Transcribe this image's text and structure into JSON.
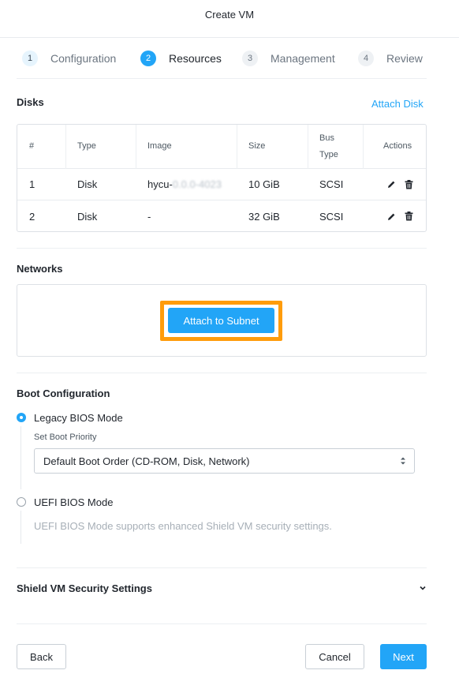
{
  "header": {
    "title": "Create VM"
  },
  "steps": [
    {
      "number": "1",
      "label": "Configuration"
    },
    {
      "number": "2",
      "label": "Resources"
    },
    {
      "number": "3",
      "label": "Management"
    },
    {
      "number": "4",
      "label": "Review"
    }
  ],
  "disks": {
    "title": "Disks",
    "attach_label": "Attach Disk",
    "columns": {
      "num": "#",
      "type": "Type",
      "image": "Image",
      "size": "Size",
      "bus_line1": "Bus",
      "bus_line2": "Type",
      "actions": "Actions"
    },
    "rows": [
      {
        "num": "1",
        "type": "Disk",
        "image": "hycu-",
        "image_redacted": "0.0.0-4023",
        "size": "10 GiB",
        "bus": "SCSI"
      },
      {
        "num": "2",
        "type": "Disk",
        "image": "-",
        "size": "32 GiB",
        "bus": "SCSI"
      }
    ],
    "action_icons": [
      "pencil-icon",
      "trash-icon"
    ]
  },
  "networks": {
    "title": "Networks",
    "attach_label": "Attach to Subnet"
  },
  "boot": {
    "title": "Boot Configuration",
    "legacy_label": "Legacy BIOS Mode",
    "priority_label": "Set Boot Priority",
    "priority_value": "Default Boot Order (CD-ROM, Disk, Network)",
    "uefi_label": "UEFI BIOS Mode",
    "uefi_help": "UEFI BIOS Mode supports enhanced Shield VM security settings.",
    "selected": "legacy"
  },
  "shield": {
    "title": "Shield VM Security Settings",
    "icon": "chevron-down-icon"
  },
  "footer": {
    "back_label": "Back",
    "cancel_label": "Cancel",
    "next_label": "Next"
  },
  "colors": {
    "accent": "#22a5f7",
    "highlight": "#ff9c0b"
  }
}
